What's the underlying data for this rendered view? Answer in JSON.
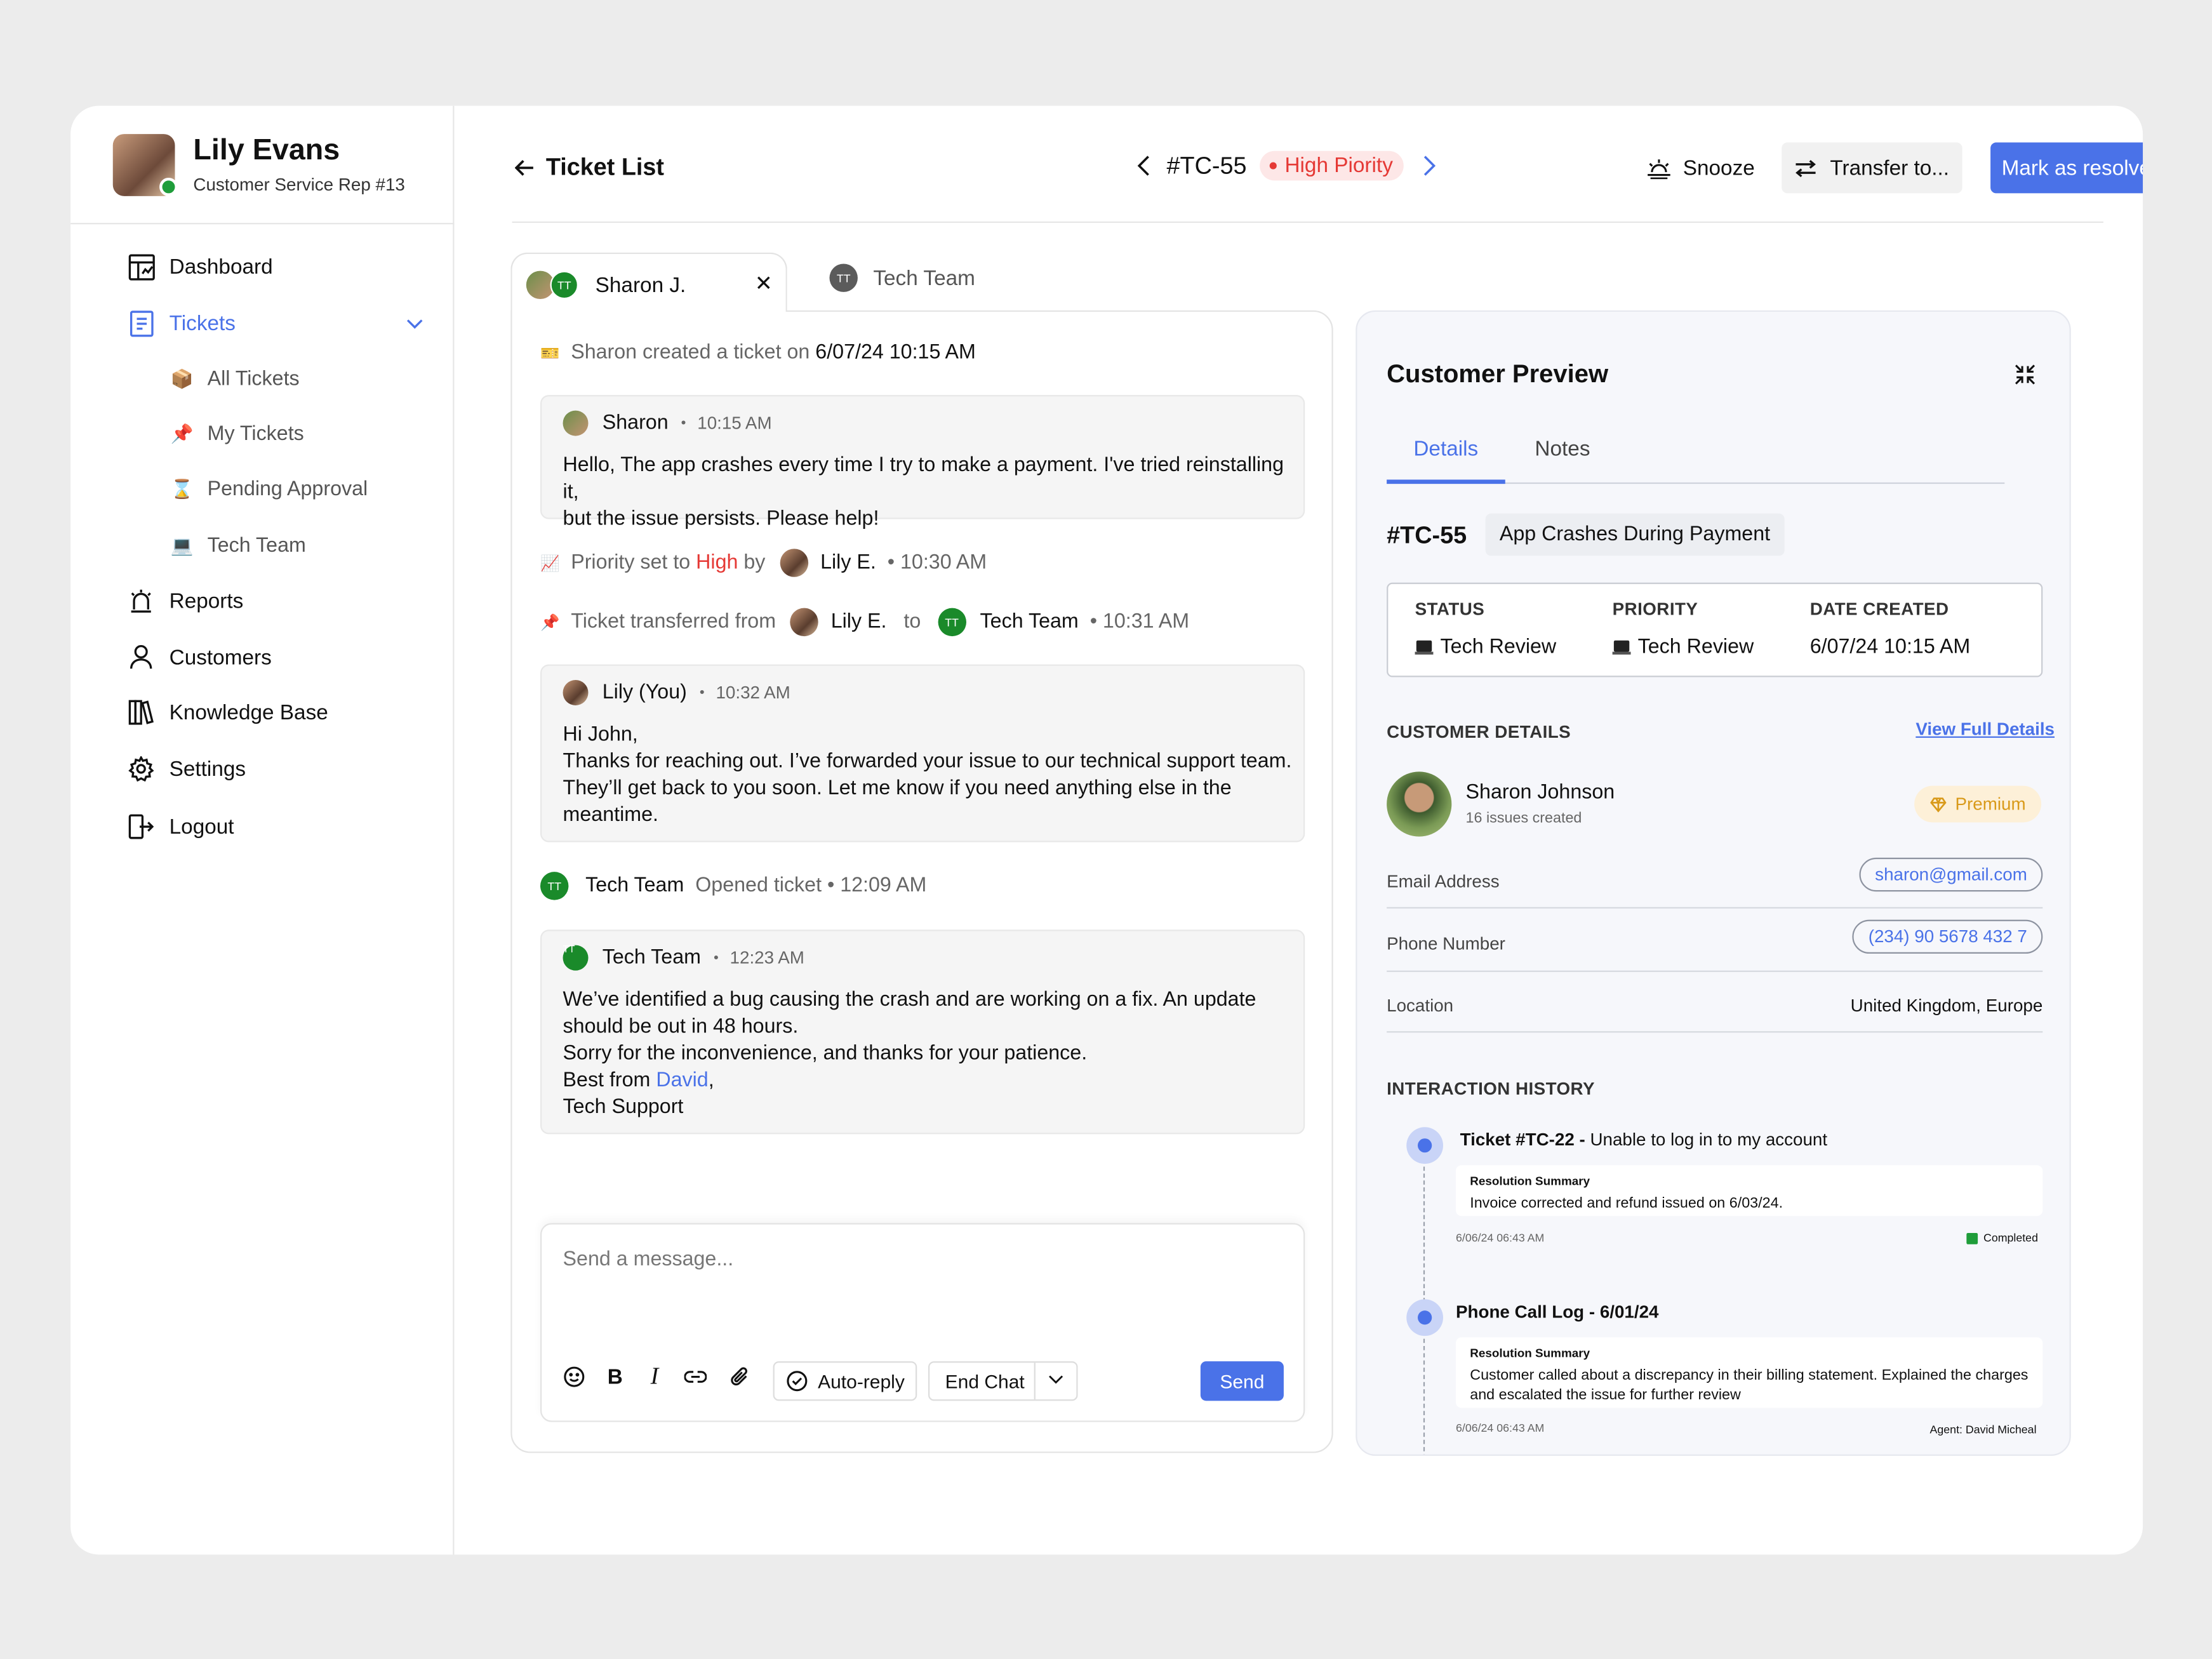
{
  "user": {
    "name": "Lily Evans",
    "role": "Customer Service Rep #13"
  },
  "nav": {
    "dashboard": "Dashboard",
    "tickets": "Tickets",
    "tickets_sub": [
      "All Tickets",
      "My Tickets",
      "Pending Approval",
      "Tech Team"
    ],
    "reports": "Reports",
    "customers": "Customers",
    "knowledge_base": "Knowledge Base",
    "settings": "Settings",
    "logout": "Logout"
  },
  "header": {
    "back_label": "Ticket List",
    "ticket_id": "#TC-55",
    "priority": "High Piority",
    "snooze": "Snooze",
    "transfer": "Transfer to...",
    "resolve": "Mark as resolved"
  },
  "tabs": {
    "active_label": "Sharon J.",
    "active_initials": "TT",
    "other_label": "Tech Team",
    "other_initials": "TT"
  },
  "chat": {
    "created": {
      "text": "Sharon created a ticket on",
      "date": "6/07/24 10:15 AM"
    },
    "msg1": {
      "sender": "Sharon",
      "time": "10:15 AM",
      "lines": [
        "Hello, The app crashes every time I try to make a payment. I've tried reinstalling it,",
        "but the issue persists. Please help!"
      ]
    },
    "priority_event": {
      "prefix": "Priority set to",
      "level": "High",
      "by": "by",
      "agent": "Lily E.",
      "time": "• 10:30 AM"
    },
    "transfer_event": {
      "prefix": "Ticket transferred from",
      "from": "Lily E.",
      "to": "to",
      "initials": "TT",
      "team": "Tech Team",
      "time": "• 10:31 AM"
    },
    "msg2": {
      "sender": "Lily (You)",
      "time": "10:32 AM",
      "lines": [
        "Hi John,",
        "Thanks for reaching out. I’ve forwarded your issue to our technical support team.",
        "They’ll get back to you soon. Let me know if you need anything else in the",
        "meantime."
      ]
    },
    "opened_event": {
      "initials": "TT",
      "team": "Tech Team",
      "text": "Opened ticket • 12:09 AM"
    },
    "msg3": {
      "sender": "Tech Team",
      "initials": "TT",
      "time": "12:23 AM",
      "lines": [
        "We’ve identified a bug causing the crash and are working on a fix. An update",
        "should be out in 48 hours.",
        "Sorry for the inconvenience, and thanks for your patience."
      ],
      "best_from": "Best from",
      "mention": "David",
      "comma": ",",
      "signature": "Tech Support"
    },
    "compose": {
      "placeholder": "Send a message...",
      "auto_reply": "Auto-reply",
      "end_chat": "End Chat",
      "send": "Send"
    }
  },
  "preview": {
    "title": "Customer Preview",
    "tabs": [
      "Details",
      "Notes"
    ],
    "ticket_id": "#TC-55",
    "ticket_title": "App Crashes During Payment",
    "status": {
      "label": "STATUS",
      "value": "Tech Review"
    },
    "priority": {
      "label": "PRIORITY",
      "value": "Tech Review"
    },
    "date_created": {
      "label": "DATE CREATED",
      "value": "6/07/24 10:15 AM"
    },
    "customer_details_label": "CUSTOMER DETAILS",
    "view_full": "View Full Details",
    "customer": {
      "name": "Sharon Johnson",
      "issues": "16 issues created",
      "tier": "Premium"
    },
    "fields": [
      {
        "label": "Email Address",
        "value": "sharon@gmail.com"
      },
      {
        "label": "Phone Number",
        "value": "(234) 90 5678 432 7"
      },
      {
        "label": "Location",
        "value": "United Kingdom, Europe"
      }
    ],
    "history_label": "INTERACTION HISTORY",
    "history": [
      {
        "title_bold": "Ticket #TC-22 -",
        "title_rest": " Unable to log in to my account",
        "summary_label": "Resolution Summary",
        "summary": [
          "Invoice corrected and refund issued on 6/03/24."
        ],
        "timestamp": "6/06/24 06:43 AM",
        "status": "Completed"
      },
      {
        "title_bold": "Phone Call Log - 6/01/24",
        "title_rest": "",
        "summary_label": "Resolution Summary",
        "summary": [
          "Customer called about a discrepancy in their billing statement. Explained the charges",
          "and escalated the issue for further review"
        ],
        "timestamp": "6/06/24 06:43 AM",
        "agent": "Agent: David Micheal"
      }
    ]
  },
  "colors": {
    "accent": "#4a72e8",
    "danger": "#e53935",
    "success": "#1f9d3a",
    "team": "#1a8a2a",
    "premium": "#d99a1a"
  }
}
